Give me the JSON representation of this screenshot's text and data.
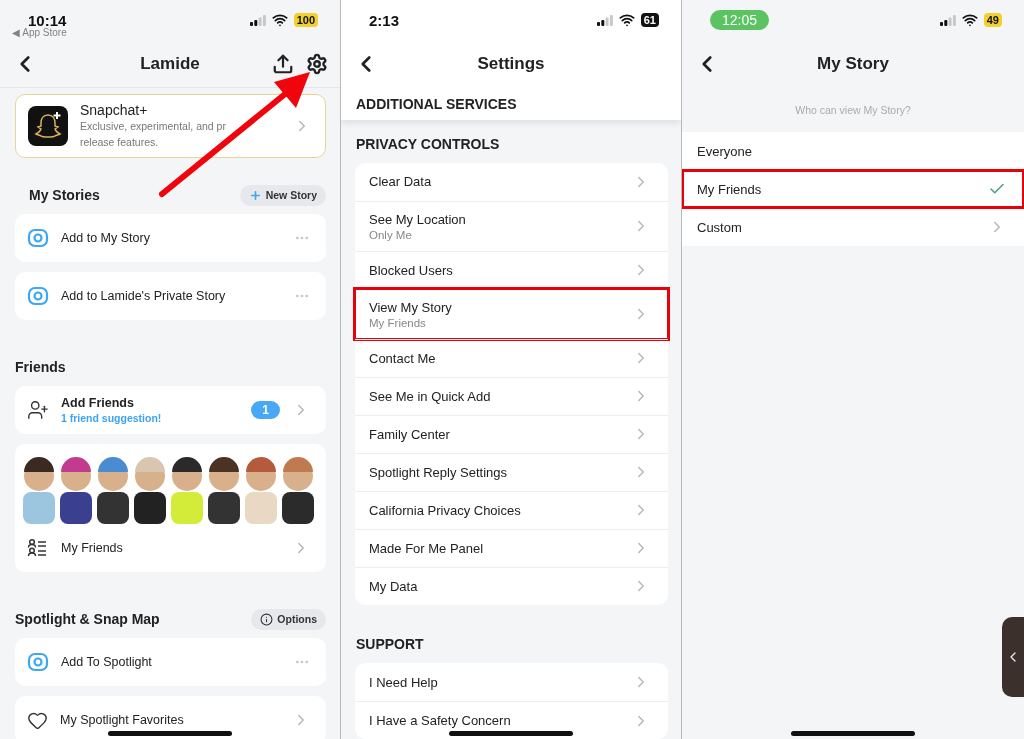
{
  "profile_screen": {
    "status_bar": {
      "time": "10:14",
      "back_label": "◀ App Store",
      "battery": "100",
      "low_power": true,
      "on_call": false
    },
    "header": {
      "title": "Lamide"
    },
    "promo": {
      "title": "Snapchat+",
      "description_lines": [
        "Exclusive, experimental, and pr",
        "release features."
      ]
    },
    "sections": [
      {
        "title": "My Stories",
        "action": {
          "label": "New Story",
          "kind": "add"
        },
        "rows": [
          {
            "kind": "action",
            "label": "Add to My Story",
            "avatars": false
          },
          {
            "kind": "action",
            "label": "Add to Lamide's Private Story",
            "avatars": false
          }
        ]
      },
      {
        "title": "Friends",
        "rows": [
          {
            "kind": "link",
            "label": "Add Friends",
            "subtitle": "1 friend suggestion!",
            "badge": "1",
            "avatars": false
          },
          {
            "kind": "link",
            "label": "My Friends",
            "avatars": true
          }
        ]
      },
      {
        "title": "Spotlight & Snap Map",
        "action": {
          "label": "Options",
          "kind": "info"
        },
        "rows": [
          {
            "kind": "action",
            "label": "Add To Spotlight",
            "avatars": false
          },
          {
            "kind": "link",
            "label": "My Spotlight Favorites",
            "avatars": false
          }
        ]
      }
    ]
  },
  "settings_screen": {
    "status_bar": {
      "time": "2:13",
      "battery": "61",
      "low_power": false,
      "on_call": false
    },
    "header": {
      "title": "Settings"
    },
    "pinned_heading": "ADDITIONAL SERVICES",
    "groups": [
      {
        "title": "PRIVACY CONTROLS",
        "rows": [
          {
            "label": "Clear Data",
            "highlighted": false
          },
          {
            "label": "See My Location",
            "value": "Only Me",
            "highlighted": false
          },
          {
            "label": "Blocked Users",
            "highlighted": false
          },
          {
            "label": "View My Story",
            "value": "My Friends",
            "highlighted": true
          },
          {
            "label": "Contact Me",
            "highlighted": false
          },
          {
            "label": "See Me in Quick Add",
            "highlighted": false
          },
          {
            "label": "Family Center",
            "highlighted": false
          },
          {
            "label": "Spotlight Reply Settings",
            "highlighted": false
          },
          {
            "label": "California Privacy Choices",
            "highlighted": false
          },
          {
            "label": "Made For Me Panel",
            "highlighted": false
          },
          {
            "label": "My Data",
            "highlighted": false
          }
        ]
      },
      {
        "title": "SUPPORT",
        "rows": [
          {
            "label": "I Need Help",
            "highlighted": false
          },
          {
            "label": "I Have a Safety Concern",
            "highlighted": false
          }
        ]
      }
    ]
  },
  "story_screen": {
    "status_bar": {
      "time": "12:05",
      "battery": "49",
      "low_power": true,
      "on_call": true
    },
    "header": {
      "title": "My Story"
    },
    "caption": "Who can view My Story?",
    "options": [
      {
        "label": "Everyone",
        "selected": false,
        "highlighted": false,
        "has_submenu": false
      },
      {
        "label": "My Friends",
        "selected": true,
        "highlighted": true,
        "has_submenu": false
      },
      {
        "label": "Custom",
        "selected": false,
        "highlighted": false,
        "has_submenu": true
      }
    ]
  }
}
